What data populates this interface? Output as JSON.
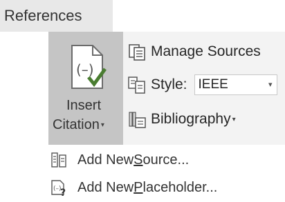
{
  "tab": {
    "label": "References"
  },
  "insert_citation": {
    "label_line1": "Insert",
    "label_line2": "Citation",
    "chevron": "▾",
    "icon": "insert-citation-icon"
  },
  "manage_sources": {
    "label": "Manage Sources",
    "icon": "manage-sources-icon"
  },
  "style": {
    "label": "Style:",
    "value": "IEEE",
    "chevron": "▾",
    "icon": "style-icon"
  },
  "bibliography": {
    "label": "Bibliography",
    "chevron": "▾",
    "icon": "bibliography-icon"
  },
  "menu": {
    "add_source": {
      "prefix": "Add New ",
      "underlined": "S",
      "suffix": "ource...",
      "icon": "add-source-icon"
    },
    "add_placeholder": {
      "prefix": "Add New ",
      "underlined": "P",
      "suffix": "laceholder...",
      "icon": "add-placeholder-icon"
    }
  },
  "colors": {
    "tab_bg": "#e8e8e8",
    "ribbon_bg": "#f3f3f3",
    "button_pressed_bg": "#c5c5c5",
    "icon_green": "#4a7d31"
  }
}
